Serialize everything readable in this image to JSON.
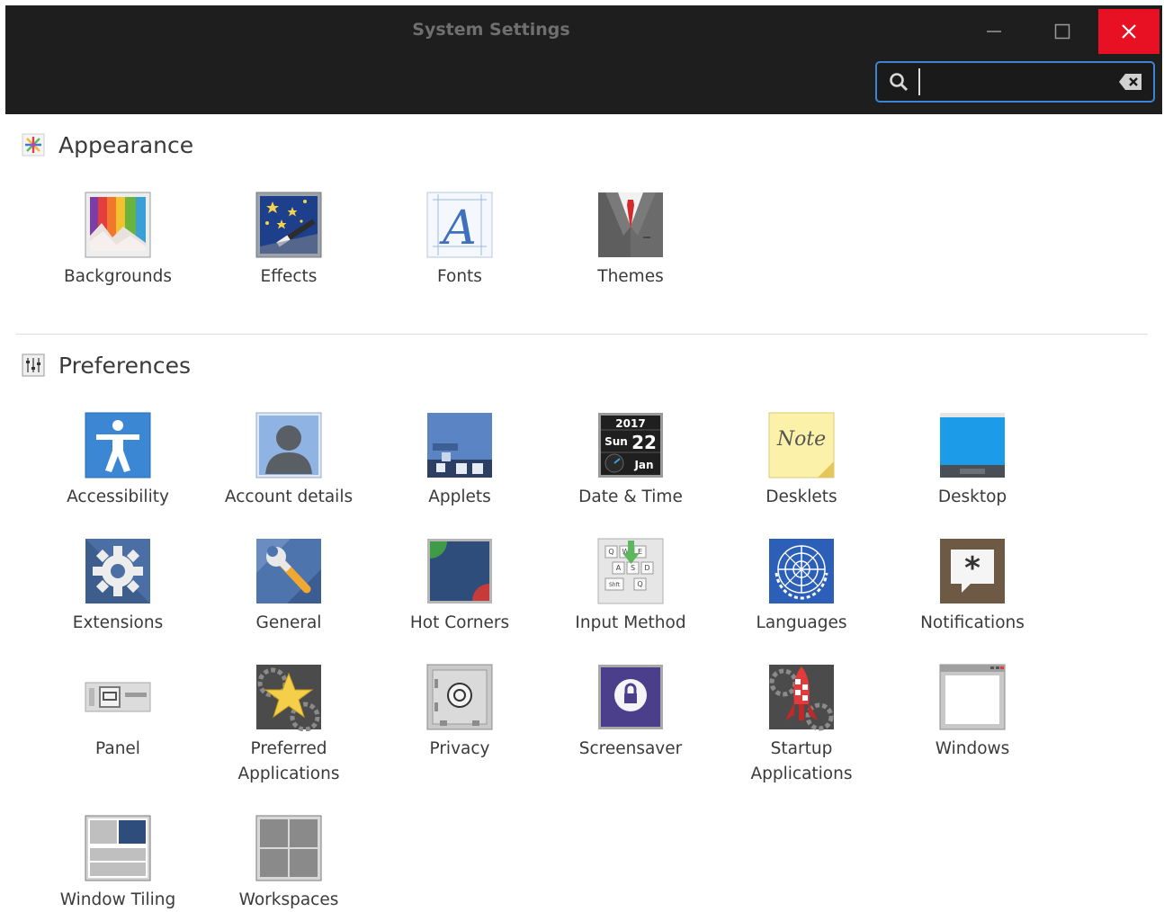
{
  "window": {
    "title": "System Settings",
    "search": {
      "value": "",
      "placeholder": ""
    },
    "controls": [
      "minimize",
      "maximize",
      "close"
    ]
  },
  "colors": {
    "titlebar": "#1e1e1e",
    "close_button": "#e81123",
    "search_border": "#3f84d4",
    "text": "#3a3a3a"
  },
  "sections": {
    "appearance": {
      "title": "Appearance",
      "icon": "appearance-icon",
      "items": [
        {
          "label": "Backgrounds",
          "icon": "backgrounds-icon"
        },
        {
          "label": "Effects",
          "icon": "effects-icon"
        },
        {
          "label": "Fonts",
          "icon": "fonts-icon"
        },
        {
          "label": "Themes",
          "icon": "themes-icon"
        }
      ]
    },
    "preferences": {
      "title": "Preferences",
      "icon": "preferences-icon",
      "items": [
        {
          "label": "Accessibility",
          "icon": "accessibility-icon"
        },
        {
          "label": "Account details",
          "icon": "account-details-icon"
        },
        {
          "label": "Applets",
          "icon": "applets-icon"
        },
        {
          "label": "Date & Time",
          "icon": "date-time-icon"
        },
        {
          "label": "Desklets",
          "icon": "desklets-icon"
        },
        {
          "label": "Desktop",
          "icon": "desktop-icon"
        },
        {
          "label": "Extensions",
          "icon": "extensions-icon"
        },
        {
          "label": "General",
          "icon": "general-icon"
        },
        {
          "label": "Hot Corners",
          "icon": "hot-corners-icon"
        },
        {
          "label": "Input Method",
          "icon": "input-method-icon"
        },
        {
          "label": "Languages",
          "icon": "languages-icon"
        },
        {
          "label": "Notifications",
          "icon": "notifications-icon"
        },
        {
          "label": "Panel",
          "icon": "panel-icon"
        },
        {
          "label": "Preferred\nApplications",
          "icon": "preferred-applications-icon"
        },
        {
          "label": "Privacy",
          "icon": "privacy-icon"
        },
        {
          "label": "Screensaver",
          "icon": "screensaver-icon"
        },
        {
          "label": "Startup\nApplications",
          "icon": "startup-applications-icon"
        },
        {
          "label": "Windows",
          "icon": "windows-icon"
        },
        {
          "label": "Window Tiling",
          "icon": "window-tiling-icon"
        },
        {
          "label": "Workspaces",
          "icon": "workspaces-icon"
        }
      ]
    }
  },
  "icon_text": {
    "date_year": "2017",
    "date_weekday": "Sun",
    "date_day": "22",
    "date_month": "Jan",
    "note_text": "Note"
  }
}
